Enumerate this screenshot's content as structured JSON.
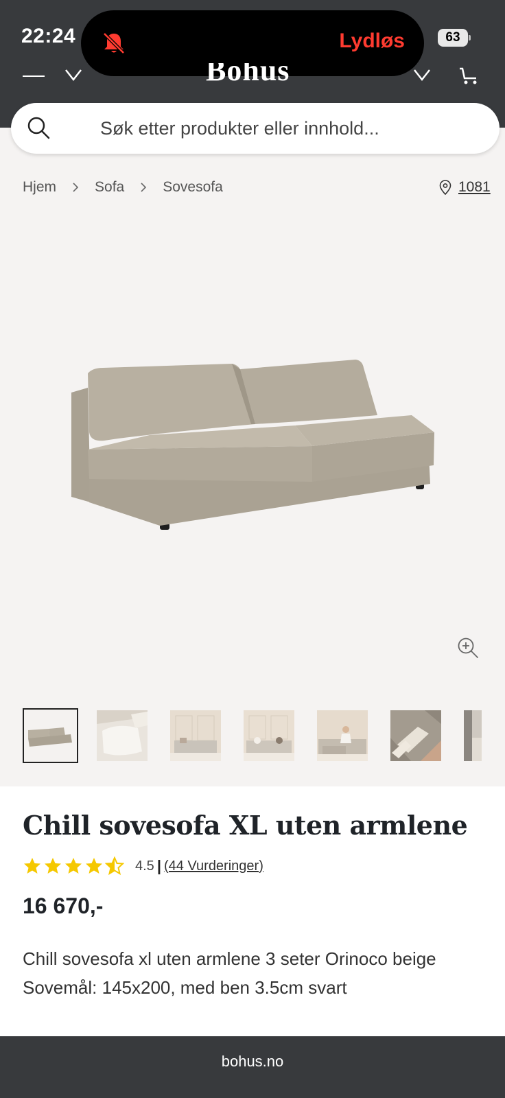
{
  "status_bar": {
    "time": "22:24",
    "silent_label": "Lydløs",
    "battery": "63"
  },
  "header": {
    "logo_text": "Bohus"
  },
  "search": {
    "placeholder": "Søk etter produkter eller innhold..."
  },
  "breadcrumb": {
    "items": [
      "Hjem",
      "Sofa",
      "Sovesofa"
    ]
  },
  "location": {
    "postal_code": "1081"
  },
  "product": {
    "title": "Chill sovesofa XL uten armlene",
    "rating": {
      "value": "4.5",
      "separator": "|",
      "reviews_label": "(44 Vurderinger)",
      "stars_filled": 4.5,
      "stars_total": 5
    },
    "price": "16 670,-",
    "description_line1": "Chill sovesofa xl uten armlene 3 seter Orinoco beige",
    "description_line2": "Sovemål: 145x200, med ben 3.5cm svart"
  },
  "browser": {
    "url": "bohus.no"
  },
  "colors": {
    "header_bg": "#383a3d",
    "page_bg": "#f5f3f2",
    "star": "#f5c800",
    "silent": "#ff3b30",
    "sofa": "#b3ab9c"
  }
}
